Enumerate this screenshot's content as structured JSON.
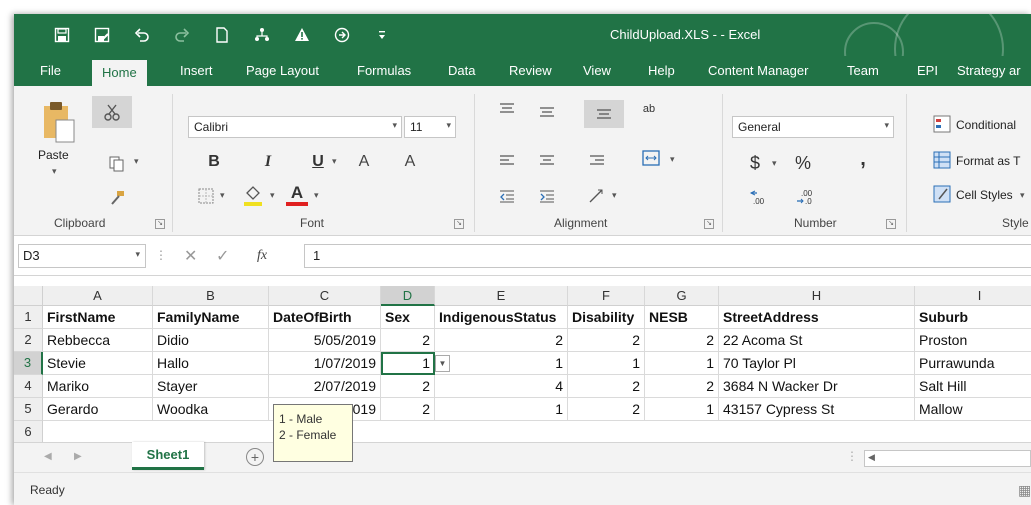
{
  "window": {
    "title": "ChildUpload.XLS -  - Excel"
  },
  "qat": [
    "save-icon",
    "save-as-icon",
    "undo-icon",
    "redo-icon",
    "new-document-icon",
    "share-icon",
    "warning-icon",
    "arrow-circle-icon",
    "customize-icon"
  ],
  "tabs": [
    {
      "label": "File"
    },
    {
      "label": "Home"
    },
    {
      "label": "Insert"
    },
    {
      "label": "Page Layout"
    },
    {
      "label": "Formulas"
    },
    {
      "label": "Data"
    },
    {
      "label": "Review"
    },
    {
      "label": "View"
    },
    {
      "label": "Help"
    },
    {
      "label": "Content Manager"
    },
    {
      "label": "Team"
    },
    {
      "label": "EPI"
    },
    {
      "label": "Strategy ar"
    }
  ],
  "ribbon": {
    "clipboard": {
      "paste": "Paste",
      "label": "Clipboard"
    },
    "font": {
      "name": "Calibri",
      "size": "11",
      "label": "Font",
      "bold": "B",
      "italic": "I",
      "underline": "U",
      "grow": "A",
      "shrink": "A",
      "fontcolor": "A"
    },
    "alignment": {
      "label": "Alignment"
    },
    "number": {
      "format": "General",
      "label": "Number",
      "currency": "$",
      "percent": "%",
      "comma": ","
    },
    "styles": {
      "conditional": "Conditional",
      "format_table": "Format as T",
      "cell_styles": "Cell Styles",
      "label": "Style"
    }
  },
  "formula_bar": {
    "name_box": "D3",
    "fx": "fx",
    "value": "1"
  },
  "columns": [
    "A",
    "B",
    "C",
    "D",
    "E",
    "F",
    "G",
    "H",
    "I"
  ],
  "rows": [
    {
      "num": "1",
      "cells": [
        "FirstName",
        "FamilyName",
        "DateOfBirth",
        "Sex",
        "IndigenousStatus",
        "Disability",
        "NESB",
        "StreetAddress",
        "Suburb"
      ]
    },
    {
      "num": "2",
      "cells": [
        "Rebbecca",
        "Didio",
        "5/05/2019",
        "2",
        "2",
        "2",
        "2",
        "22 Acoma St",
        "Proston"
      ]
    },
    {
      "num": "3",
      "cells": [
        "Stevie",
        "Hallo",
        "1/07/2019",
        "1",
        "1",
        "1",
        "1",
        "70 Taylor Pl",
        "Purrawunda"
      ]
    },
    {
      "num": "4",
      "cells": [
        "Mariko",
        "Stayer",
        "2/07/2019",
        "2",
        "4",
        "2",
        "2",
        "3684 N Wacker Dr",
        "Salt Hill"
      ]
    },
    {
      "num": "5",
      "cells": [
        "Gerardo",
        "Woodka",
        "019",
        "2",
        "1",
        "2",
        "1",
        "43157 Cypress St",
        "Mallow"
      ]
    },
    {
      "num": "6",
      "cells": [
        "",
        "",
        "",
        "",
        "",
        "",
        "",
        "",
        ""
      ]
    }
  ],
  "tooltip": {
    "line1": "1 - Male",
    "line2": "2 - Female"
  },
  "sheets": [
    {
      "name": "Sheet1"
    }
  ],
  "add_sheet": "+",
  "status": {
    "text": "Ready"
  },
  "colors": {
    "excel_green": "#217346",
    "ribbon_bg": "#f3f3f3",
    "tooltip_bg": "#ffffe1"
  }
}
